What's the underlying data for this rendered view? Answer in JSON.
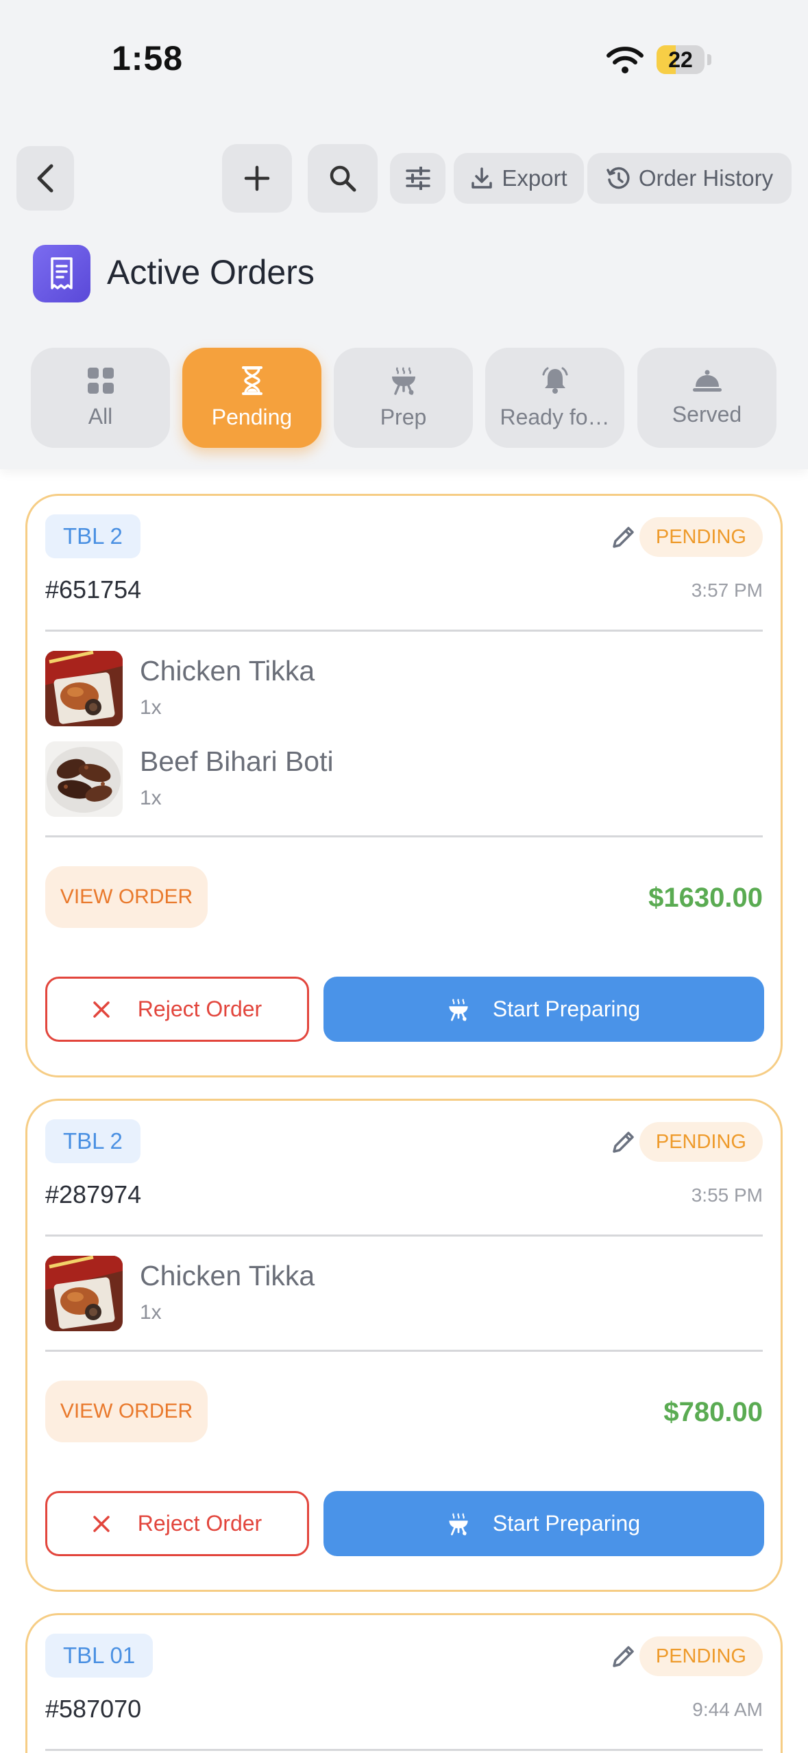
{
  "status_bar": {
    "time": "1:58",
    "battery": "22",
    "battery_level": 0.22
  },
  "toolbar": {
    "export_label": "Export",
    "history_label": "Order History"
  },
  "page": {
    "title": "Active Orders"
  },
  "filters": [
    {
      "label": "All",
      "icon": "grid-icon",
      "active": false
    },
    {
      "label": "Pending",
      "icon": "hourglass-icon",
      "active": true
    },
    {
      "label": "Prep",
      "icon": "grill-icon",
      "active": false
    },
    {
      "label": "Ready fo…",
      "icon": "bell-icon",
      "active": false
    },
    {
      "label": "Served",
      "icon": "cloche-icon",
      "active": false
    }
  ],
  "orders": [
    {
      "table": "TBL 2",
      "status": "PENDING",
      "id": "#651754",
      "time": "3:57 PM",
      "items": [
        {
          "name": "Chicken Tikka",
          "qty": "1x"
        },
        {
          "name": "Beef Bihari Boti",
          "qty": "1x"
        }
      ],
      "view_label": "VIEW ORDER",
      "total": "$1630.00",
      "reject_label": "Reject Order",
      "start_label": "Start Preparing"
    },
    {
      "table": "TBL 2",
      "status": "PENDING",
      "id": "#287974",
      "time": "3:55 PM",
      "items": [
        {
          "name": "Chicken Tikka",
          "qty": "1x"
        }
      ],
      "view_label": "VIEW ORDER",
      "total": "$780.00",
      "reject_label": "Reject Order",
      "start_label": "Start Preparing"
    },
    {
      "table": "TBL 01",
      "status": "PENDING",
      "id": "#587070",
      "time": "9:44 AM"
    }
  ],
  "colors": {
    "accent_orange": "#f5a13d",
    "primary_blue": "#4a93e8",
    "reject_red": "#e2453c",
    "total_green": "#5aab52",
    "card_border": "#f6cd85"
  }
}
